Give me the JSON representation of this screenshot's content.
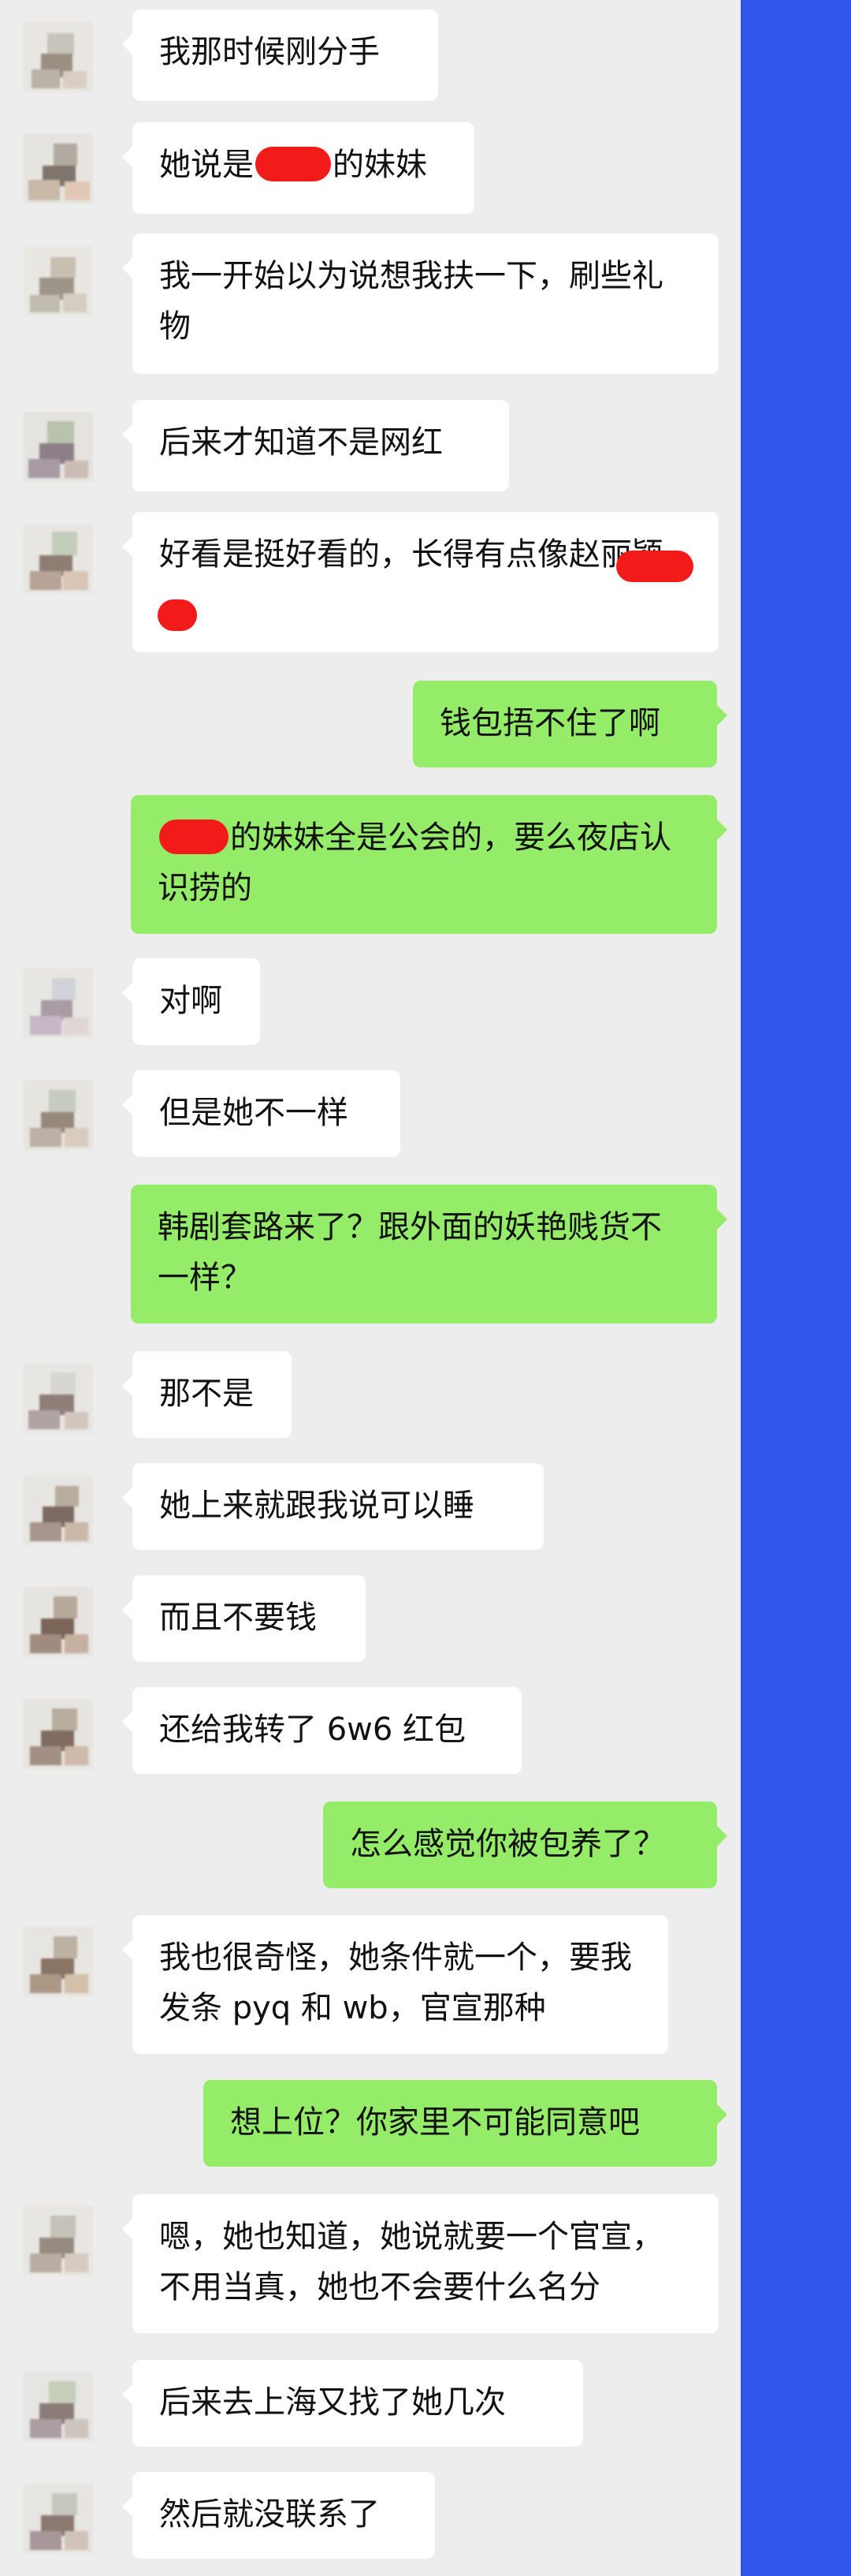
{
  "conversation": {
    "messages": [
      {
        "text": "我那时候刚分手"
      },
      {
        "before": "她说是",
        "after": "的妹妹"
      },
      {
        "text": "我一开始以为说想我扶一下，刷些礼物"
      },
      {
        "text": "后来才知道不是网红"
      },
      {
        "text": "好看是挺好看的，长得有点像赵丽颖"
      },
      {
        "text": "钱包捂不住了啊"
      },
      {
        "after": "的妹妹全是公会的，要么夜店认识捞的"
      },
      {
        "text": "对啊"
      },
      {
        "text": "但是她不一样"
      },
      {
        "text": "韩剧套路来了？跟外面的妖艳贱货不一样？"
      },
      {
        "text": "那不是"
      },
      {
        "text": "她上来就跟我说可以睡"
      },
      {
        "text": "而且不要钱"
      },
      {
        "text": "还给我转了 6w6 红包"
      },
      {
        "text": "怎么感觉你被包养了？"
      },
      {
        "text": "我也很奇怪，她条件就一个，要我发条 pyq 和 wb，官宣那种"
      },
      {
        "text": "想上位？你家里不可能同意吧"
      },
      {
        "text": "嗯，她也知道，她说就要一个官宣，不用当真，她也不会要什么名分"
      },
      {
        "text": "后来去上海又找了她几次"
      },
      {
        "text": "然后就没联系了"
      }
    ]
  },
  "colors": {
    "background": "#ededed",
    "incoming_bubble": "#ffffff",
    "outgoing_bubble": "#95ec69",
    "redaction": "#f31a1a",
    "side_strip": "#2f55e9"
  }
}
